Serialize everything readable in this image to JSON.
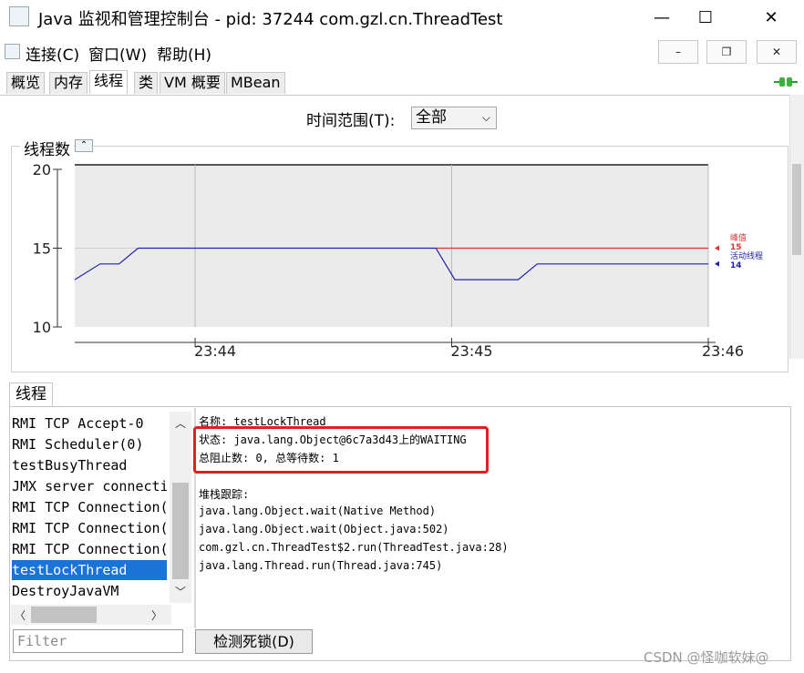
{
  "window": {
    "title": "Java 监视和管理控制台 - pid: 37244 com.gzl.cn.ThreadTest",
    "minimize_glyph": "—",
    "maximize_glyph": "☐",
    "close_glyph": "✕"
  },
  "menubar": {
    "items": [
      "连接(C)",
      "窗口(W)",
      "帮助(H)"
    ],
    "mdi_minimize": "–",
    "mdi_restore": "❐",
    "mdi_close": "✕"
  },
  "tabs": [
    {
      "label": "概览",
      "active": false
    },
    {
      "label": "内存",
      "active": false
    },
    {
      "label": "线程",
      "active": true
    },
    {
      "label": "类",
      "active": false
    },
    {
      "label": "VM 概要",
      "active": false
    },
    {
      "label": "MBean",
      "active": false
    }
  ],
  "time_range": {
    "label": "时间范围(T):",
    "selected": "全部"
  },
  "chart_data": {
    "type": "line",
    "title": "线程数",
    "ylim": [
      10,
      20
    ],
    "yticks": [
      "20",
      "15",
      "10"
    ],
    "xticks": [
      "23:44",
      "23:45",
      "23:46"
    ],
    "series": [
      {
        "name": "峰值",
        "color": "#dd3333",
        "latest": "15",
        "points": [
          [
            0.57,
            15
          ],
          [
            1.0,
            15
          ]
        ]
      },
      {
        "name": "活动线程",
        "color": "#2222aa",
        "latest": "14",
        "points": [
          [
            0,
            13
          ],
          [
            0.04,
            14
          ],
          [
            0.07,
            14
          ],
          [
            0.1,
            15
          ],
          [
            0.57,
            15
          ],
          [
            0.6,
            13
          ],
          [
            0.7,
            13
          ],
          [
            0.73,
            14
          ],
          [
            1.0,
            14
          ]
        ]
      }
    ]
  },
  "threads": {
    "tab_label": "线程",
    "list": [
      "RMI TCP Accept-0",
      "RMI Scheduler(0)",
      "testBusyThread",
      "JMX server connection",
      "RMI TCP Connection(",
      "RMI TCP Connection(",
      "RMI TCP Connection(",
      "testLockThread",
      "DestroyJavaVM"
    ],
    "selected_index": 7,
    "filter_placeholder": "Filter",
    "deadlock_button": "检测死锁(D)"
  },
  "detail": {
    "name_line": "名称: testLockThread",
    "state_line": "状态: java.lang.Object@6c7a3d43上的WAITING",
    "counts_line": "总阻止数: 0, 总等待数: 1",
    "stack_header": "堆栈跟踪:",
    "stack": [
      "java.lang.Object.wait(Native Method)",
      "java.lang.Object.wait(Object.java:502)",
      "com.gzl.cn.ThreadTest$2.run(ThreadTest.java:28)",
      "java.lang.Thread.run(Thread.java:745)"
    ]
  },
  "watermark": "CSDN @怪咖软妹@"
}
